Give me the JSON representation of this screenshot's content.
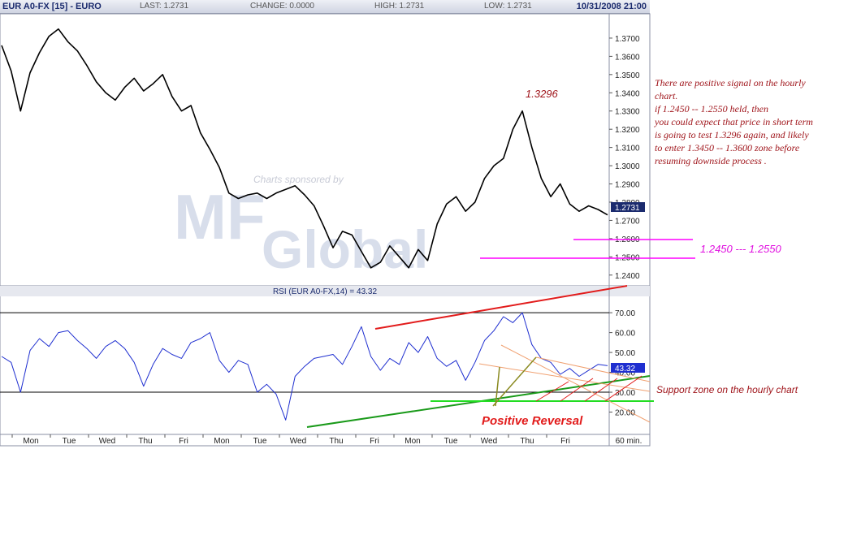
{
  "header": {
    "title": "EUR A0-FX [15] - EURO",
    "last": "LAST: 1.2731",
    "change": "CHANGE: 0.0000",
    "high": "HIGH: 1.2731",
    "low": "LOW: 1.2731",
    "datetime": "10/31/2008 21:00"
  },
  "watermark": {
    "sponsor": "Charts sponsored by",
    "logo_top": "MF",
    "logo_bottom": "Global"
  },
  "colors": {
    "price": "#000000",
    "rsi": "#1f2fd0",
    "magenta": "#ff00ff",
    "red": "#e21b1b",
    "green": "#1a9a1a",
    "lime": "#22dd22",
    "orange": "#f0a070",
    "olive": "#8a8a20",
    "annotation": "#a0161c"
  },
  "chart_data": [
    {
      "type": "line",
      "title": "EUR A0-FX [15] - EURO",
      "ylim": [
        1.235,
        1.382
      ],
      "y_ticks": [
        "1.3700",
        "1.3600",
        "1.3500",
        "1.3400",
        "1.3300",
        "1.3200",
        "1.3100",
        "1.3000",
        "1.2900",
        "1.2800",
        "1.2700",
        "1.2600",
        "1.2500",
        "1.2400"
      ],
      "x_ticks": [
        "Mon",
        "Tue",
        "Wed",
        "Thu",
        "Fri",
        "Mon",
        "Tue",
        "Wed",
        "Thu",
        "Fri",
        "Mon",
        "Tue",
        "Wed",
        "Thu",
        "Fri"
      ],
      "last_value_label": "1.2731",
      "series": [
        {
          "values": [
            1.366,
            1.352,
            1.33,
            1.351,
            1.362,
            1.371,
            1.375,
            1.368,
            1.363,
            1.355,
            1.346,
            1.34,
            1.336,
            1.343,
            1.348,
            1.341,
            1.345,
            1.35,
            1.338,
            1.33,
            1.333,
            1.318,
            1.309,
            1.299,
            1.285,
            1.282,
            1.284,
            1.285,
            1.282,
            1.285,
            1.287,
            1.289,
            1.284,
            1.278,
            1.267,
            1.255,
            1.264,
            1.262,
            1.253,
            1.244,
            1.247,
            1.256,
            1.25,
            1.244,
            1.254,
            1.248,
            1.268,
            1.279,
            1.283,
            1.275,
            1.28,
            1.293,
            1.3,
            1.304,
            1.32,
            1.33,
            1.31,
            1.293,
            1.283,
            1.29,
            1.279,
            1.275,
            1.278,
            1.276,
            1.273
          ]
        }
      ],
      "annotations": [
        "1.3296",
        "1.2450 --- 1.2550"
      ]
    },
    {
      "type": "line",
      "title": "RSI (EUR A0-FX,14) = 43.32",
      "ylim": [
        10,
        77
      ],
      "y_ticks": [
        "70.00",
        "60.00",
        "50.00",
        "40.00",
        "30.00",
        "20.00"
      ],
      "x_ticks": [
        "Mon",
        "Tue",
        "Wed",
        "Thu",
        "Fri",
        "Mon",
        "Tue",
        "Wed",
        "Thu",
        "Fri",
        "60 min."
      ],
      "last_value_label": "43.32",
      "reference_lines": [
        70,
        30
      ],
      "series": [
        {
          "name": "RSI (EUR A0-FX,14)",
          "values": [
            48,
            45,
            30,
            51,
            57,
            53,
            60,
            61,
            56,
            52,
            47,
            53,
            56,
            52,
            45,
            33,
            44,
            52,
            49,
            47,
            55,
            57,
            60,
            46,
            40,
            46,
            44,
            30,
            34,
            29,
            16,
            38,
            43,
            47,
            48,
            49,
            44,
            53,
            63,
            48,
            41,
            47,
            44,
            55,
            50,
            58,
            47,
            43,
            46,
            36,
            45,
            56,
            61,
            68,
            65,
            70,
            54,
            47,
            45,
            39,
            42,
            38,
            41,
            44,
            43.32
          ]
        }
      ],
      "annotations": [
        "Positive Reversal",
        "Support zone on the hourly chart"
      ]
    }
  ],
  "commentary": {
    "lines": [
      "There are positive signal on the hourly",
      "chart.",
      "if 1.2450 -- 1.2550 held, then",
      "you could expect that price in short term",
      "is going to test 1.3296 again, and likely",
      "to enter 1.3450 -- 1.3600 zone before",
      "resuming downside process ."
    ]
  }
}
